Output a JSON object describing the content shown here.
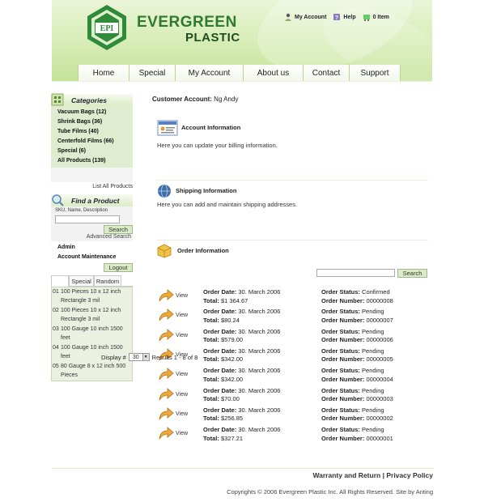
{
  "brand": {
    "logo_text": "EPI",
    "line1": "EVERGREEN",
    "line2": "PLASTIC"
  },
  "toplinks": [
    {
      "label": "My Account",
      "icon": "user-icon"
    },
    {
      "label": "Help",
      "icon": "help-icon"
    },
    {
      "label": "0 Item",
      "icon": "cart-icon"
    }
  ],
  "nav": [
    "Home",
    "Special",
    "My Account",
    "About us",
    "Contact",
    "Support"
  ],
  "sidebar": {
    "categories_title": "Categories",
    "categories": [
      "Vacuum Bags (12)",
      "Shrink Bags (36)",
      "Tube Films (40)",
      "Centerfold Films (66)",
      "Special (6)",
      "All Products (139)"
    ],
    "list_all": "List All Products",
    "find_title": "Find a Product",
    "find_label": "SKU, Name, Description",
    "search_button": "Search",
    "advanced_search": "Advanced Search",
    "admin": "Admin",
    "account_maintenance": "Account Maintenance",
    "logout": "Logout",
    "tabs": [
      "",
      "Special",
      "Random"
    ],
    "products": [
      {
        "num": "01",
        "name": "100 Pieces 10 x 12 inch Rectangle 3 mil"
      },
      {
        "num": "02",
        "name": "100 Pieces 10 x 12 inch Rectangle 3 mil"
      },
      {
        "num": "03",
        "name": "100 Gauge 10 inch 1500 feet"
      },
      {
        "num": "04",
        "name": "100 Gauge 10 inch 1500 feet"
      },
      {
        "num": "05",
        "name": "80 Gauge 8 x 12 inch 500 Pieces"
      }
    ]
  },
  "main": {
    "customer_label": "Customer Account:",
    "customer_name": "Ng Andy",
    "account_info": {
      "title": "Account Information",
      "text": "Here you can update your billing information."
    },
    "shipping_info": {
      "title": "Shipping Information",
      "text": "Here you can add and maintain shipping addresses."
    },
    "order_info": {
      "title": "Order Information"
    },
    "search_button": "Search",
    "view_label": "View",
    "date_label": "Order Date:",
    "total_label": "Total:",
    "status_label": "Order Status:",
    "number_label": "Order Number:",
    "orders": [
      {
        "date": "30. March 2006",
        "total": "$1 364.67",
        "status": "Confirmed",
        "number": "00000008"
      },
      {
        "date": "30. March 2006",
        "total": "$80.24",
        "status": "Pending",
        "number": "00000007"
      },
      {
        "date": "30. March 2006",
        "total": "$579.00",
        "status": "Pending",
        "number": "00000006"
      },
      {
        "date": "30. March 2006",
        "total": "$342.00",
        "status": "Pending",
        "number": "00000005"
      },
      {
        "date": "30. March 2006",
        "total": "$342.00",
        "status": "Pending",
        "number": "00000004"
      },
      {
        "date": "30. March 2006",
        "total": "$70.00",
        "status": "Pending",
        "number": "00000003"
      },
      {
        "date": "30. March 2006",
        "total": "$256.85",
        "status": "Pending",
        "number": "00000002"
      },
      {
        "date": "30. March 2006",
        "total": "$327.21",
        "status": "Pending",
        "number": "00000001"
      }
    ],
    "display_label": "Display #",
    "display_value": "30",
    "results_text": "Results 1 - 8 of 8"
  },
  "footer": {
    "warranty": "Warranty and Return",
    "separator": "|",
    "privacy": "Privacy Policy",
    "copyright": "Copyrights © 2006 Evergreen Plastic Inc. All Rights Reserved. Site by Anting"
  },
  "colors": {
    "header_green": "#c5e39a",
    "brand_green": "#2f7a2f",
    "side_green": "#dfecd0"
  }
}
